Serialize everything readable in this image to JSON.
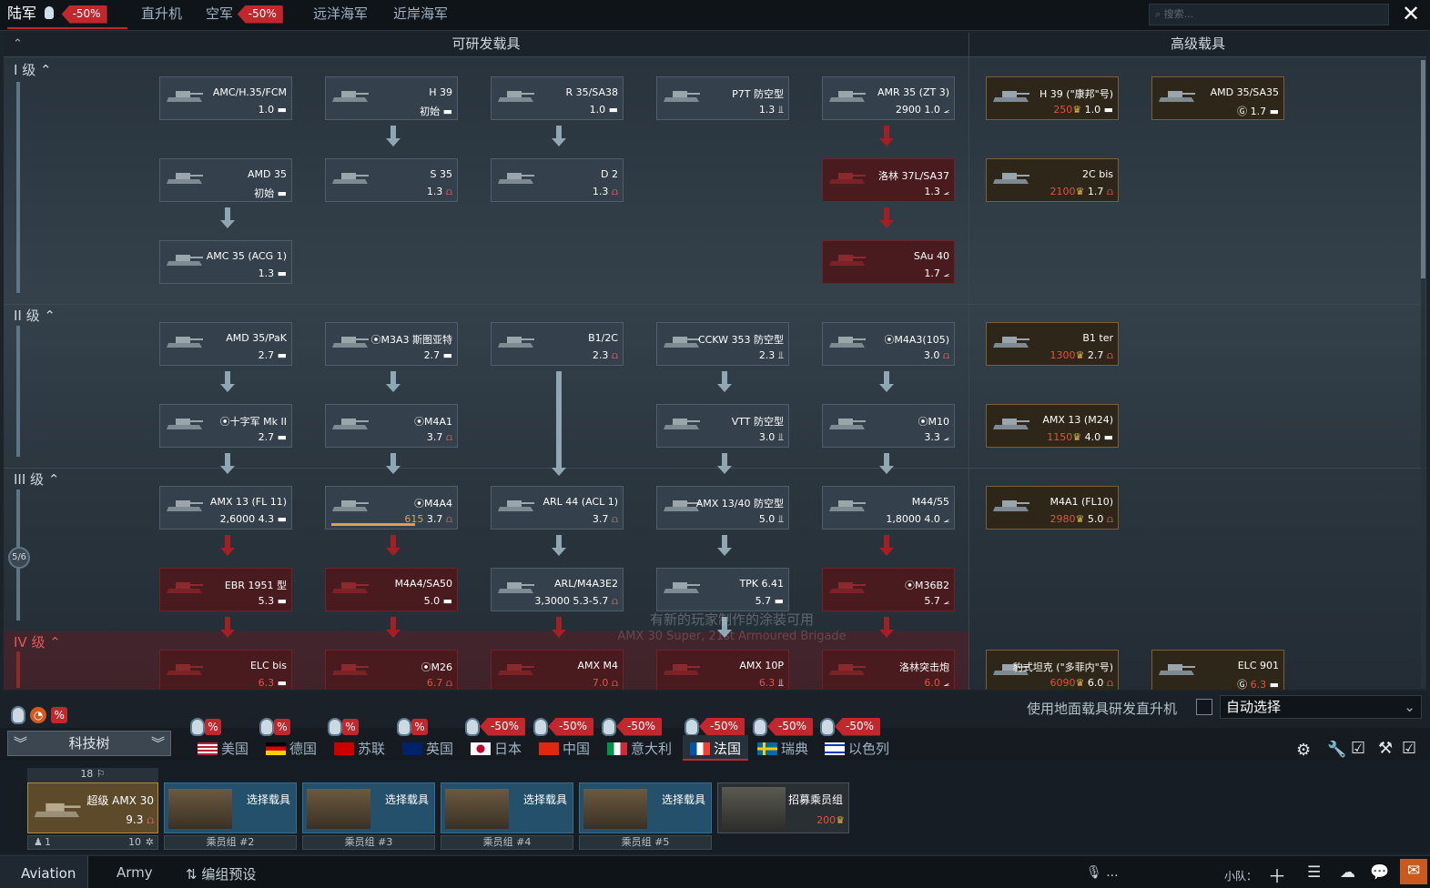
{
  "top_tabs": [
    {
      "label": "陆军",
      "sale": "-50%",
      "active": true
    },
    {
      "label": "直升机"
    },
    {
      "label": "空军",
      "sale": "-50%"
    },
    {
      "label": "远洋海军"
    },
    {
      "label": "近岸海军"
    }
  ],
  "search": {
    "placeholder": "搜索..."
  },
  "tree": {
    "header_research": "可研发载具",
    "header_premium": "高级载具",
    "ranks": [
      "I 级",
      "II 级",
      "III 级",
      "IV 级"
    ],
    "rank_progress": "5/6",
    "notice": "有新的玩家制作的涂装可用",
    "notice_sub": "AMX 30 Super, 21st Armoured Brigade",
    "vehicles": [
      {
        "name": "AMC/H.35/FCM",
        "br": "1.0"
      },
      {
        "name": "H 39",
        "status": "初始"
      },
      {
        "name": "R 35/SA38",
        "br": "1.0"
      },
      {
        "name": "P7T 防空型",
        "br": "1.3"
      },
      {
        "name": "AMR 35 (ZT 3)",
        "cost": "2900",
        "br": "1.0"
      },
      {
        "name": "H 39 (\"康邦\"号)",
        "cost": "250",
        "br": "1.0"
      },
      {
        "name": "AMD 35/SA35",
        "br": "1.7"
      },
      {
        "name": "AMD 35",
        "status": "初始"
      },
      {
        "name": "S 35",
        "br": "1.3"
      },
      {
        "name": "D 2",
        "br": "1.3"
      },
      {
        "name": "洛林 37L/SA37",
        "br": "1.3"
      },
      {
        "name": "2C bis",
        "cost": "2100",
        "br": "1.7"
      },
      {
        "name": "AMC 35 (ACG 1)",
        "br": "1.3"
      },
      {
        "name": "SAu 40",
        "br": "1.7"
      },
      {
        "name": "AMD 35/PaK",
        "br": "2.7"
      },
      {
        "name": "M3A3 斯图亚特",
        "br": "2.7"
      },
      {
        "name": "B1/2C",
        "br": "2.3"
      },
      {
        "name": "CCKW 353 防空型",
        "br": "2.3"
      },
      {
        "name": "M4A3(105)",
        "br": "3.0"
      },
      {
        "name": "B1 ter",
        "cost": "1300",
        "br": "2.7"
      },
      {
        "name": "十字军 Mk II",
        "br": "2.7"
      },
      {
        "name": "M4A1",
        "br": "3.7"
      },
      {
        "name": "VTT 防空型",
        "br": "3.0"
      },
      {
        "name": "M10",
        "br": "3.3"
      },
      {
        "name": "AMX 13 (M24)",
        "cost": "1150",
        "br": "4.0"
      },
      {
        "name": "AMX 13 (FL 11)",
        "cost": "2,6000",
        "br": "4.3"
      },
      {
        "name": "M4A4",
        "cost": "615",
        "br": "3.7"
      },
      {
        "name": "ARL 44 (ACL 1)",
        "br": "3.7"
      },
      {
        "name": "AMX 13/40 防空型",
        "br": "5.0"
      },
      {
        "name": "M44/55",
        "cost": "1,8000",
        "br": "4.0"
      },
      {
        "name": "M4A1 (FL10)",
        "cost": "2980",
        "br": "5.0"
      },
      {
        "name": "EBR 1951 型",
        "br": "5.3"
      },
      {
        "name": "M4A4/SA50",
        "br": "5.0"
      },
      {
        "name": "ARL/M4A3E2",
        "cost": "3,3000",
        "br": "5.3-5.7"
      },
      {
        "name": "TPK 6.41",
        "br": "5.7"
      },
      {
        "name": "M36B2",
        "br": "5.7"
      },
      {
        "name": "ELC bis",
        "br": "6.3"
      },
      {
        "name": "M26",
        "br": "6.7"
      },
      {
        "name": "AMX M4",
        "br": "7.0"
      },
      {
        "name": "AMX 10P",
        "br": "6.3"
      },
      {
        "name": "洛林突击炮",
        "br": "6.0"
      },
      {
        "name": "豹式坦克 (\"多菲内\"号)",
        "cost": "6090",
        "br": "6.0"
      },
      {
        "name": "ELC 901",
        "br": "6.3"
      }
    ]
  },
  "options": {
    "heli_label": "使用地面载具研发直升机",
    "auto_select": "自动选择",
    "tech_tree_btn": "科技树"
  },
  "nations": [
    {
      "label": "美国",
      "sale": ""
    },
    {
      "label": "德国",
      "sale": ""
    },
    {
      "label": "苏联",
      "sale": ""
    },
    {
      "label": "英国",
      "sale": ""
    },
    {
      "label": "日本",
      "sale": "-50%"
    },
    {
      "label": "中国",
      "sale": "-50%"
    },
    {
      "label": "意大利",
      "sale": "-50%"
    },
    {
      "label": "法国",
      "sale": "-50%",
      "active": true
    },
    {
      "label": "瑞典",
      "sale": "-50%"
    },
    {
      "label": "以色列",
      "sale": "-50%"
    }
  ],
  "crew": {
    "main": {
      "count": "18",
      "name": "超级 AMX 30",
      "br": "9.3",
      "crew_num": "1",
      "level": "10"
    },
    "slots": [
      {
        "action": "选择载具",
        "label": "乘员组 #2"
      },
      {
        "action": "选择载具",
        "label": "乘员组 #3"
      },
      {
        "action": "选择载具",
        "label": "乘员组 #4"
      },
      {
        "action": "选择载具",
        "label": "乘员组 #5"
      }
    ],
    "recruit": {
      "label": "招募乘员组",
      "cost": "200"
    }
  },
  "bottom": {
    "tabs": [
      "Aviation",
      "Army"
    ],
    "preset": "编组预设",
    "squad": "小队：",
    "mic": "..."
  },
  "colors": {
    "accent_red": "#c0282d",
    "research_card": "#34414c",
    "premium_card": "#2e2618",
    "locked_card": "#4a1b1e"
  }
}
